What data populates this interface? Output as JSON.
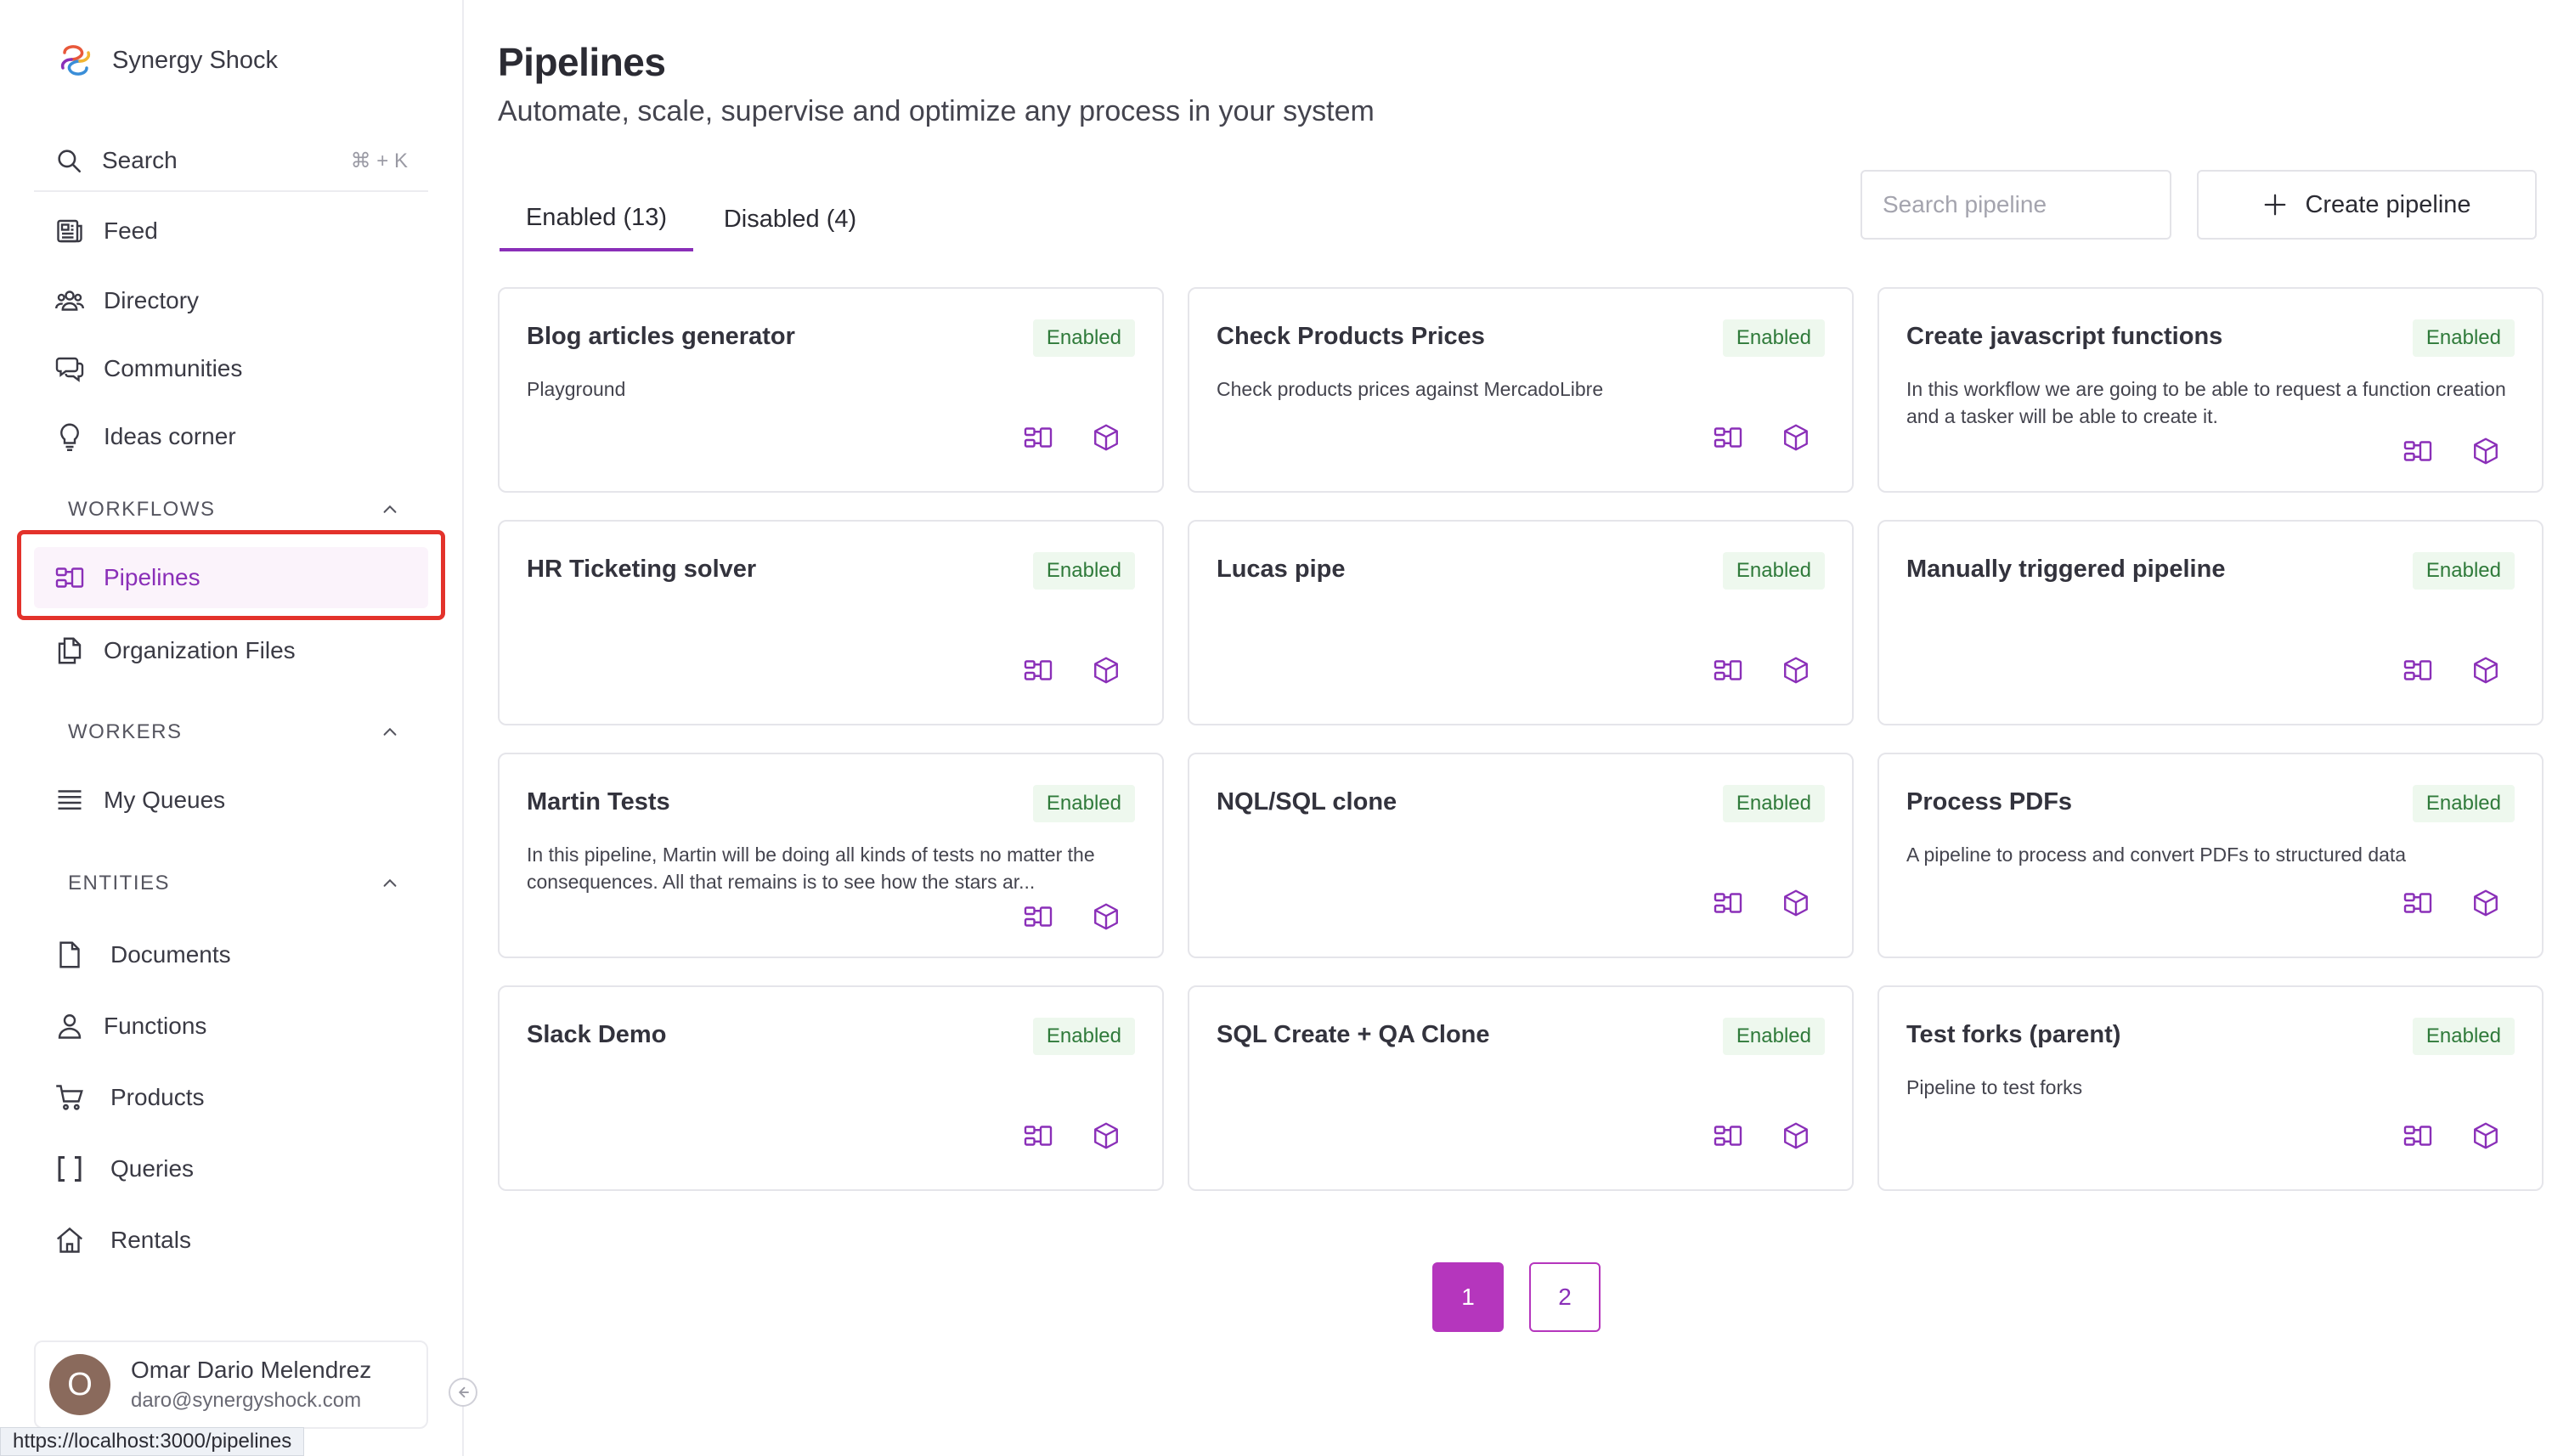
{
  "app": {
    "name": "Synergy Shock"
  },
  "sidebar": {
    "search": {
      "label": "Search",
      "shortcut": "⌘ + K"
    },
    "top_items": [
      {
        "label": "Feed",
        "icon": "newspaper-icon"
      },
      {
        "label": "Directory",
        "icon": "users-group-icon"
      },
      {
        "label": "Communities",
        "icon": "chat-bubbles-icon"
      },
      {
        "label": "Ideas corner",
        "icon": "lightbulb-icon"
      }
    ],
    "sections": [
      {
        "title": "WORKFLOWS",
        "items": [
          {
            "label": "Pipelines",
            "icon": "pipeline-icon",
            "active": true
          },
          {
            "label": "Organization Files",
            "icon": "files-icon"
          }
        ]
      },
      {
        "title": "WORKERS",
        "items": [
          {
            "label": "My Queues",
            "icon": "queue-list-icon"
          }
        ]
      },
      {
        "title": "ENTITIES",
        "items": [
          {
            "label": "Documents",
            "icon": "document-icon"
          },
          {
            "label": "Functions",
            "icon": "user-icon"
          },
          {
            "label": "Products",
            "icon": "cart-icon"
          },
          {
            "label": "Queries",
            "icon": "brackets-icon"
          },
          {
            "label": "Rentals",
            "icon": "home-icon"
          }
        ]
      }
    ],
    "user": {
      "initial": "O",
      "name": "Omar Dario Melendrez",
      "email": "daro@synergyshock.com"
    },
    "status_url": "https://localhost:3000/pipelines"
  },
  "main": {
    "title": "Pipelines",
    "subtitle": "Automate, scale, supervise and optimize any process in your system",
    "tabs": [
      {
        "label": "Enabled (13)",
        "active": true
      },
      {
        "label": "Disabled (4)",
        "active": false
      }
    ],
    "search_placeholder": "Search pipeline",
    "create_label": "Create pipeline",
    "pipelines": [
      {
        "title": "Blog articles generator",
        "status": "Enabled",
        "description": "Playground"
      },
      {
        "title": "Check Products Prices",
        "status": "Enabled",
        "description": "Check products prices against MercadoLibre"
      },
      {
        "title": "Create javascript functions",
        "status": "Enabled",
        "description": "In this workflow we are going to be able to request a function creation and a tasker will be able to create it."
      },
      {
        "title": "HR Ticketing solver",
        "status": "Enabled",
        "description": ""
      },
      {
        "title": "Lucas pipe",
        "status": "Enabled",
        "description": ""
      },
      {
        "title": "Manually triggered pipeline",
        "status": "Enabled",
        "description": ""
      },
      {
        "title": "Martin Tests",
        "status": "Enabled",
        "description": "In this pipeline, Martin will be doing all kinds of tests no matter the consequences. All that remains is to see how the stars ar..."
      },
      {
        "title": "NQL/SQL clone",
        "status": "Enabled",
        "description": ""
      },
      {
        "title": "Process PDFs",
        "status": "Enabled",
        "description": "A pipeline to process and convert PDFs to structured data"
      },
      {
        "title": "Slack Demo",
        "status": "Enabled",
        "description": ""
      },
      {
        "title": "SQL Create + QA Clone",
        "status": "Enabled",
        "description": ""
      },
      {
        "title": "Test forks (parent)",
        "status": "Enabled",
        "description": "Pipeline to test forks"
      }
    ],
    "pagination": {
      "current": "1",
      "other": "2"
    }
  },
  "colors": {
    "accent": "#8a2fb8",
    "pagination": "#b536bd",
    "badge_bg": "#eef8ee",
    "badge_text": "#2f7a3a",
    "highlight": "#e3322b"
  }
}
